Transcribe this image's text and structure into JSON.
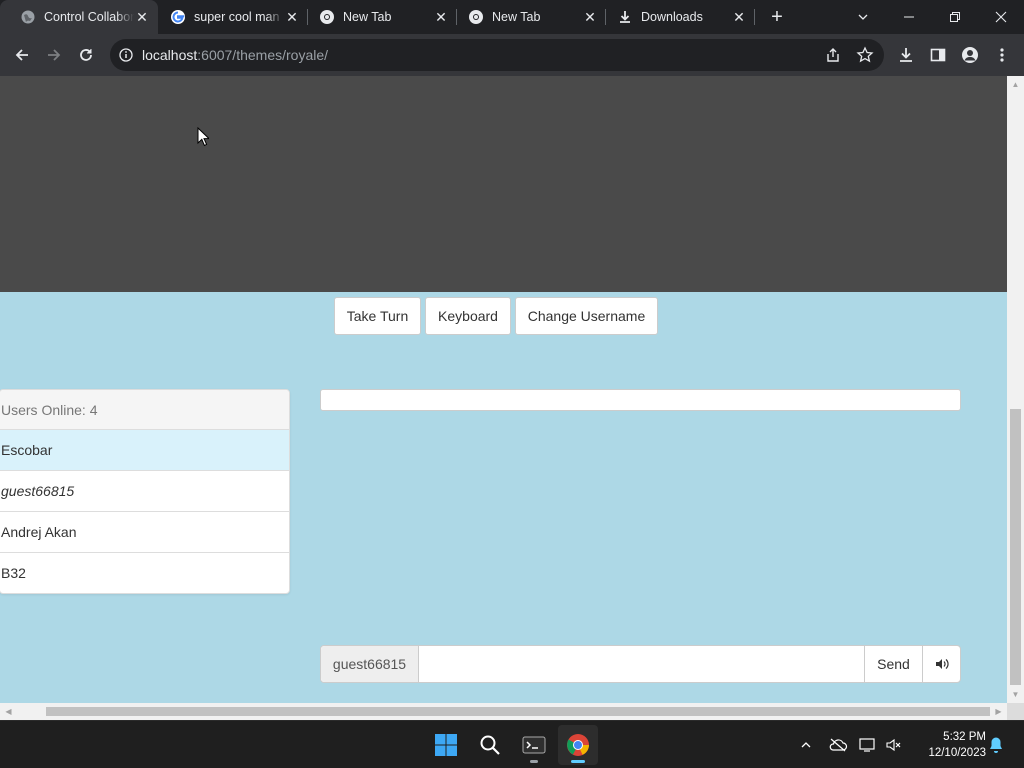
{
  "browser": {
    "tabs": [
      {
        "title": "Control Collaborator",
        "icon": "globe-icon",
        "active": true
      },
      {
        "title": "super cool man",
        "icon": "google-icon",
        "active": false
      },
      {
        "title": "New Tab",
        "icon": "chrome-icon",
        "active": false
      },
      {
        "title": "New Tab",
        "icon": "chrome-icon",
        "active": false
      },
      {
        "title": "Downloads",
        "icon": "download-icon",
        "active": false
      }
    ],
    "url_host": "localhost",
    "url_rest": ":6007/themes/royale/"
  },
  "page": {
    "buttons": {
      "take_turn": "Take Turn",
      "keyboard": "Keyboard",
      "change_username": "Change Username"
    },
    "users_header": "Users Online: 4",
    "users": [
      {
        "name": "Escobar",
        "highlighted": true,
        "current": false
      },
      {
        "name": "guest66815",
        "highlighted": false,
        "current": true
      },
      {
        "name": "Andrej Akan",
        "highlighted": false,
        "current": false
      },
      {
        "name": "B32",
        "highlighted": false,
        "current": false
      }
    ],
    "chat": {
      "username": "guest66815",
      "input_value": "",
      "send_label": "Send"
    },
    "colors": {
      "page_background": "#add8e6",
      "stream_background": "#4a4a4a",
      "highlight_row": "#d9f2fb"
    }
  },
  "taskbar": {
    "time": "5:32 PM",
    "date": "12/10/2023"
  }
}
